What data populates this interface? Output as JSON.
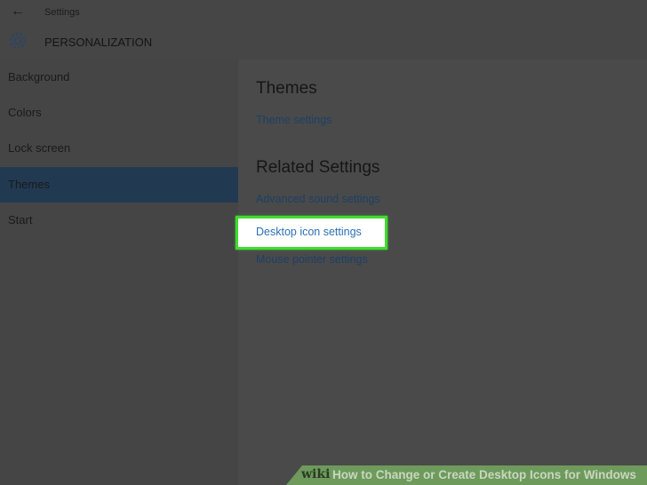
{
  "header": {
    "back_icon": "arrow-left-icon",
    "app_title": "Settings",
    "section_icon": "gear-icon",
    "section_title": "PERSONALIZATION"
  },
  "sidebar": {
    "items": [
      {
        "label": "Background"
      },
      {
        "label": "Colors"
      },
      {
        "label": "Lock screen"
      },
      {
        "label": "Themes",
        "selected": true
      },
      {
        "label": "Start"
      }
    ]
  },
  "main": {
    "themes_heading": "Themes",
    "theme_settings": "Theme settings",
    "related_heading": "Related Settings",
    "links": [
      "Advanced sound settings",
      "Desktop icon settings",
      "Mouse pointer settings"
    ]
  },
  "banner": {
    "logo": "wiki",
    "title": "How to Change or Create Desktop Icons for Windows"
  },
  "colors": {
    "selected": "#213a52",
    "highlight": "#3fdc2c",
    "link": "#1c4066"
  }
}
